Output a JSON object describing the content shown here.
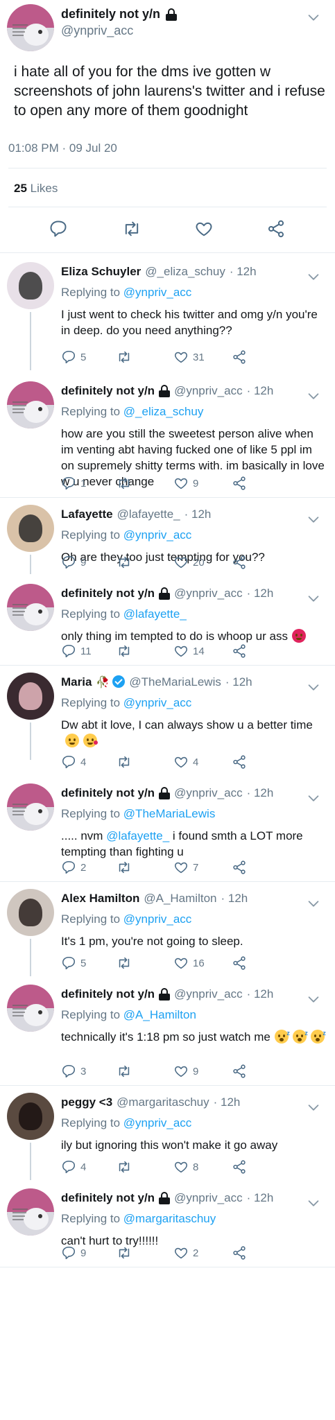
{
  "main_tweet": {
    "display_name": "definitely not y/n",
    "handle": "@ynpriv_acc",
    "text": "i hate all of you for the dms ive gotten w screenshots of john laurens's twitter and i refuse to open any more of them goodnight",
    "timestamp": "01:08 PM · 09 Jul 20",
    "likes_count": "25",
    "likes_label": "Likes"
  },
  "replies": [
    {
      "name": "Eliza Schuyler",
      "handle": "@_eliza_schuy",
      "time": "· 12h",
      "replying_prefix": "Replying to",
      "replying_to": "@ynpriv_acc",
      "text": "I just went to check his twitter and omg y/n you're in deep. do you need anything??",
      "replies": "5",
      "retweets": "",
      "likes": "31"
    },
    {
      "name": "definitely not y/n",
      "handle": "@ynpriv_acc",
      "time": "· 12h",
      "replying_prefix": "Replying to",
      "replying_to": "@_eliza_schuy",
      "text": "how are you still the sweetest person alive when im venting abt having fucked one of like 5 ppl im on supremely shitty terms with. im basically in love w u never change",
      "replies": "1",
      "retweets": "",
      "likes": "9"
    },
    {
      "name": "Lafayette",
      "handle": "@lafayette_",
      "time": "· 12h",
      "replying_prefix": "Replying to",
      "replying_to": "@ynpriv_acc",
      "text": "Oh are they too just tempting for you??",
      "replies": "9",
      "retweets": "",
      "likes": "20"
    },
    {
      "name": "definitely not y/n",
      "handle": "@ynpriv_acc",
      "time": "· 12h",
      "replying_prefix": "Replying to",
      "replying_to": "@lafayette_",
      "text": "only thing im tempted to do is whoop ur ass",
      "replies": "11",
      "retweets": "",
      "likes": "14"
    },
    {
      "name": "Maria",
      "handle": "@TheMariaLewis",
      "time": "· 12h",
      "replying_prefix": "Replying to",
      "replying_to": "@ynpriv_acc",
      "text": "Dw abt it love, I can always show u a better time",
      "replies": "4",
      "retweets": "",
      "likes": "4"
    },
    {
      "name": "definitely not y/n",
      "handle": "@ynpriv_acc",
      "time": "· 12h",
      "replying_prefix": "Replying to",
      "replying_to": "@TheMariaLewis",
      "text_prefix": ".....  nvm",
      "text_mention": "@lafayette_",
      "text": "i found smth a LOT more tempting than fighting u",
      "replies": "2",
      "retweets": "",
      "likes": "7"
    },
    {
      "name": "Alex Hamilton",
      "handle": "@A_Hamilton",
      "time": "· 12h",
      "replying_prefix": "Replying to",
      "replying_to": "@ynpriv_acc",
      "text": "It's 1 pm, you're not going to sleep.",
      "replies": "5",
      "retweets": "",
      "likes": "16"
    },
    {
      "name": "definitely not y/n",
      "handle": "@ynpriv_acc",
      "time": "· 12h",
      "replying_prefix": "Replying to",
      "replying_to": "@A_Hamilton",
      "text": "technically it's 1:18 pm so just watch me",
      "replies": "3",
      "retweets": "",
      "likes": "9"
    },
    {
      "name": "peggy <3",
      "handle": "@margaritaschuy",
      "time": "· 12h",
      "replying_prefix": "Replying to",
      "replying_to": "@ynpriv_acc",
      "text": "ily but ignoring this won't make it go away",
      "replies": "4",
      "retweets": "",
      "likes": "8"
    },
    {
      "name": "definitely not y/n",
      "handle": "@ynpriv_acc",
      "time": "· 12h",
      "replying_prefix": "Replying to",
      "replying_to": "@margaritaschuy",
      "text": "can't hurt to try!!!!!!",
      "replies": "9",
      "retweets": "",
      "likes": "2"
    }
  ],
  "icons": {
    "reply": "reply-icon",
    "retweet": "retweet-icon",
    "like": "heart-icon",
    "share": "share-icon",
    "more": "chevron-down-icon",
    "protected": "lock-icon",
    "verified": "verified-badge-icon"
  },
  "colors": {
    "link": "#1da1f2",
    "muted": "#657786",
    "text": "#14171a",
    "divider": "#e6ecf0",
    "action": "#4a6a85"
  }
}
